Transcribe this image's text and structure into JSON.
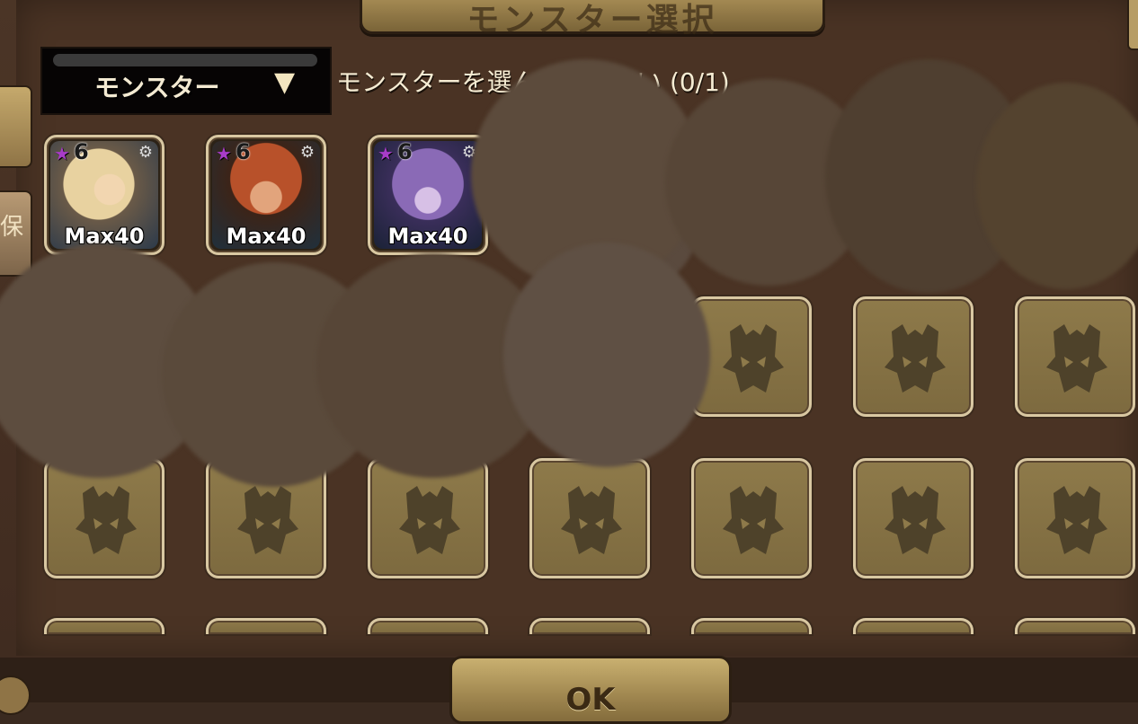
{
  "header": {
    "title": "モンスター選択"
  },
  "side_tabs": {
    "second_label": "保"
  },
  "filter": {
    "dropdown_label": "モンスター",
    "dropdown_arrow": "▼"
  },
  "instruction": "モンスターを選んでください (0/1)",
  "monsters": [
    {
      "stars": "6",
      "level": "Max40"
    },
    {
      "stars": "6",
      "level": "Max40"
    },
    {
      "stars": "6",
      "level": "Max40"
    }
  ],
  "ok_button": {
    "label": "OK"
  },
  "colors": {
    "panel": "#4a3324",
    "slot_empty": "#8e7a4a",
    "slot_border": "#d9c8a2",
    "text": "#f5ecd3",
    "star": "#a83cc8"
  },
  "icons": {
    "empty_slot": "monster-mask-icon",
    "rarity": "star-icon",
    "skill": "gear-icon"
  }
}
